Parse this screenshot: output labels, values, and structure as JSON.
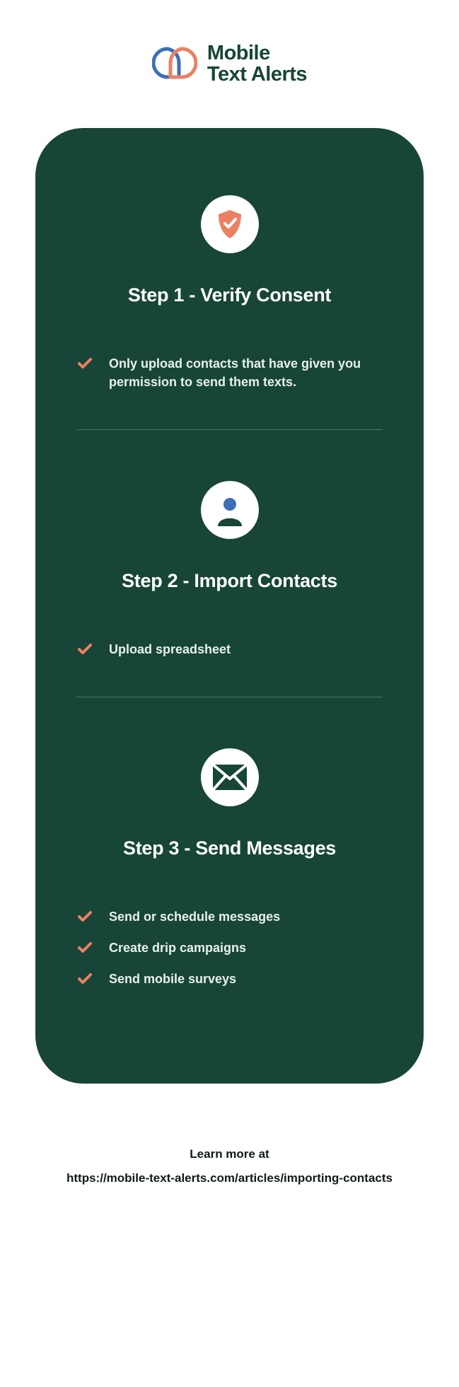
{
  "logo": {
    "line1": "Mobile",
    "line2": "Text Alerts"
  },
  "steps": [
    {
      "title": "Step 1 - Verify Consent",
      "bullets": [
        "Only upload contacts that have given you permission to send them texts."
      ]
    },
    {
      "title": "Step 2 - Import Contacts",
      "bullets": [
        "Upload spreadsheet"
      ]
    },
    {
      "title": "Step 3 - Send Messages",
      "bullets": [
        "Send or schedule messages",
        "Create drip campaigns",
        "Send mobile surveys"
      ]
    }
  ],
  "footer": {
    "line1": "Learn more at",
    "line2": "https://mobile-text-alerts.com/articles/importing-contacts"
  },
  "colors": {
    "card": "#174537",
    "accent": "#ed8063",
    "blue": "#3b6fb8"
  }
}
